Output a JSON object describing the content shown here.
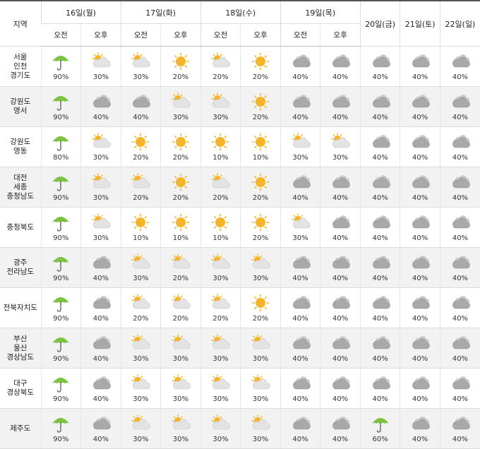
{
  "header": {
    "region_label": "지역",
    "days": [
      "16일(월)",
      "17일(화)",
      "18일(수)",
      "19일(목)",
      "20일(금)",
      "21일(토)",
      "22일(일)"
    ],
    "am_label": "오전",
    "pm_label": "오후"
  },
  "rows": [
    {
      "region": "서울\n인천\n경기도",
      "cells": [
        {
          "icon": "umbrella-icon",
          "pct": "90%"
        },
        {
          "icon": "sun-cloud-icon",
          "pct": "30%"
        },
        {
          "icon": "sun-cloud-icon",
          "pct": "30%"
        },
        {
          "icon": "sun-icon",
          "pct": "20%"
        },
        {
          "icon": "sun-cloud-icon",
          "pct": "20%"
        },
        {
          "icon": "sun-icon",
          "pct": "20%"
        },
        {
          "icon": "cloud-icon",
          "pct": "40%"
        },
        {
          "icon": "cloud-icon",
          "pct": "40%"
        },
        {
          "icon": "cloud-icon",
          "pct": "40%"
        },
        {
          "icon": "cloud-icon",
          "pct": "40%"
        },
        {
          "icon": "cloud-icon",
          "pct": "40%"
        }
      ]
    },
    {
      "region": "강원도\n영서",
      "cells": [
        {
          "icon": "umbrella-icon",
          "pct": "90%"
        },
        {
          "icon": "cloud-icon",
          "pct": "40%"
        },
        {
          "icon": "cloud-icon",
          "pct": "40%"
        },
        {
          "icon": "sun-cloud-icon",
          "pct": "30%"
        },
        {
          "icon": "sun-cloud-icon",
          "pct": "30%"
        },
        {
          "icon": "sun-icon",
          "pct": "20%"
        },
        {
          "icon": "cloud-icon",
          "pct": "40%"
        },
        {
          "icon": "cloud-icon",
          "pct": "40%"
        },
        {
          "icon": "cloud-icon",
          "pct": "40%"
        },
        {
          "icon": "cloud-icon",
          "pct": "40%"
        },
        {
          "icon": "cloud-icon",
          "pct": "40%"
        }
      ]
    },
    {
      "region": "강원도\n영동",
      "cells": [
        {
          "icon": "umbrella-icon",
          "pct": "80%"
        },
        {
          "icon": "sun-cloud-icon",
          "pct": "30%"
        },
        {
          "icon": "sun-icon",
          "pct": "20%"
        },
        {
          "icon": "sun-icon",
          "pct": "20%"
        },
        {
          "icon": "sun-icon",
          "pct": "10%"
        },
        {
          "icon": "sun-icon",
          "pct": "10%"
        },
        {
          "icon": "sun-cloud-icon",
          "pct": "30%"
        },
        {
          "icon": "sun-cloud-icon",
          "pct": "30%"
        },
        {
          "icon": "cloud-icon",
          "pct": "40%"
        },
        {
          "icon": "cloud-icon",
          "pct": "40%"
        },
        {
          "icon": "cloud-icon",
          "pct": "40%"
        }
      ]
    },
    {
      "region": "대전\n세종\n충청남도",
      "cells": [
        {
          "icon": "umbrella-icon",
          "pct": "90%"
        },
        {
          "icon": "sun-cloud-icon",
          "pct": "30%"
        },
        {
          "icon": "sun-cloud-icon",
          "pct": "20%"
        },
        {
          "icon": "sun-icon",
          "pct": "20%"
        },
        {
          "icon": "sun-cloud-icon",
          "pct": "20%"
        },
        {
          "icon": "sun-icon",
          "pct": "20%"
        },
        {
          "icon": "cloud-icon",
          "pct": "40%"
        },
        {
          "icon": "cloud-icon",
          "pct": "40%"
        },
        {
          "icon": "cloud-icon",
          "pct": "40%"
        },
        {
          "icon": "cloud-icon",
          "pct": "40%"
        },
        {
          "icon": "cloud-icon",
          "pct": "40%"
        }
      ]
    },
    {
      "region": "충청북도",
      "cells": [
        {
          "icon": "umbrella-icon",
          "pct": "90%"
        },
        {
          "icon": "sun-cloud-icon",
          "pct": "30%"
        },
        {
          "icon": "sun-icon",
          "pct": "10%"
        },
        {
          "icon": "sun-icon",
          "pct": "10%"
        },
        {
          "icon": "sun-icon",
          "pct": "10%"
        },
        {
          "icon": "sun-icon",
          "pct": "20%"
        },
        {
          "icon": "sun-cloud-icon",
          "pct": "30%"
        },
        {
          "icon": "cloud-icon",
          "pct": "40%"
        },
        {
          "icon": "cloud-icon",
          "pct": "40%"
        },
        {
          "icon": "cloud-icon",
          "pct": "40%"
        },
        {
          "icon": "cloud-icon",
          "pct": "40%"
        }
      ]
    },
    {
      "region": "광주\n전라남도",
      "cells": [
        {
          "icon": "umbrella-icon",
          "pct": "90%"
        },
        {
          "icon": "cloud-icon",
          "pct": "40%"
        },
        {
          "icon": "sun-cloud-icon",
          "pct": "30%"
        },
        {
          "icon": "sun-cloud-icon",
          "pct": "20%"
        },
        {
          "icon": "sun-cloud-icon",
          "pct": "30%"
        },
        {
          "icon": "sun-cloud-icon",
          "pct": "30%"
        },
        {
          "icon": "cloud-icon",
          "pct": "40%"
        },
        {
          "icon": "cloud-icon",
          "pct": "40%"
        },
        {
          "icon": "cloud-icon",
          "pct": "40%"
        },
        {
          "icon": "cloud-icon",
          "pct": "40%"
        },
        {
          "icon": "cloud-icon",
          "pct": "40%"
        }
      ]
    },
    {
      "region": "전북자치도",
      "cells": [
        {
          "icon": "umbrella-icon",
          "pct": "90%"
        },
        {
          "icon": "cloud-icon",
          "pct": "40%"
        },
        {
          "icon": "sun-cloud-icon",
          "pct": "20%"
        },
        {
          "icon": "sun-cloud-icon",
          "pct": "20%"
        },
        {
          "icon": "sun-cloud-icon",
          "pct": "20%"
        },
        {
          "icon": "sun-icon",
          "pct": "20%"
        },
        {
          "icon": "cloud-icon",
          "pct": "40%"
        },
        {
          "icon": "cloud-icon",
          "pct": "40%"
        },
        {
          "icon": "cloud-icon",
          "pct": "40%"
        },
        {
          "icon": "cloud-icon",
          "pct": "40%"
        },
        {
          "icon": "cloud-icon",
          "pct": "40%"
        }
      ]
    },
    {
      "region": "부산\n울산\n경상남도",
      "cells": [
        {
          "icon": "umbrella-icon",
          "pct": "90%"
        },
        {
          "icon": "cloud-icon",
          "pct": "40%"
        },
        {
          "icon": "sun-cloud-icon",
          "pct": "30%"
        },
        {
          "icon": "sun-cloud-icon",
          "pct": "30%"
        },
        {
          "icon": "sun-cloud-icon",
          "pct": "30%"
        },
        {
          "icon": "sun-cloud-icon",
          "pct": "30%"
        },
        {
          "icon": "cloud-icon",
          "pct": "40%"
        },
        {
          "icon": "cloud-icon",
          "pct": "40%"
        },
        {
          "icon": "cloud-icon",
          "pct": "40%"
        },
        {
          "icon": "cloud-icon",
          "pct": "40%"
        },
        {
          "icon": "cloud-icon",
          "pct": "40%"
        }
      ]
    },
    {
      "region": "대구\n경상북도",
      "cells": [
        {
          "icon": "umbrella-icon",
          "pct": "90%"
        },
        {
          "icon": "cloud-icon",
          "pct": "40%"
        },
        {
          "icon": "sun-cloud-icon",
          "pct": "30%"
        },
        {
          "icon": "sun-cloud-icon",
          "pct": "30%"
        },
        {
          "icon": "sun-cloud-icon",
          "pct": "30%"
        },
        {
          "icon": "sun-cloud-icon",
          "pct": "30%"
        },
        {
          "icon": "cloud-icon",
          "pct": "40%"
        },
        {
          "icon": "cloud-icon",
          "pct": "40%"
        },
        {
          "icon": "cloud-icon",
          "pct": "40%"
        },
        {
          "icon": "cloud-icon",
          "pct": "40%"
        },
        {
          "icon": "cloud-icon",
          "pct": "40%"
        }
      ]
    },
    {
      "region": "제주도",
      "cells": [
        {
          "icon": "umbrella-icon",
          "pct": "90%"
        },
        {
          "icon": "cloud-icon",
          "pct": "40%"
        },
        {
          "icon": "sun-cloud-icon",
          "pct": "30%"
        },
        {
          "icon": "sun-cloud-icon",
          "pct": "30%"
        },
        {
          "icon": "sun-cloud-icon",
          "pct": "30%"
        },
        {
          "icon": "sun-cloud-icon",
          "pct": "30%"
        },
        {
          "icon": "cloud-icon",
          "pct": "40%"
        },
        {
          "icon": "cloud-icon",
          "pct": "40%"
        },
        {
          "icon": "umbrella-icon",
          "pct": "60%"
        },
        {
          "icon": "cloud-icon",
          "pct": "40%"
        },
        {
          "icon": "cloud-icon",
          "pct": "40%"
        }
      ]
    }
  ],
  "colors": {
    "umbrella": "#7dc242",
    "sun": "#f5b52a",
    "cloud": "#a9a9a9",
    "alt_row": "#f2f2f2"
  }
}
